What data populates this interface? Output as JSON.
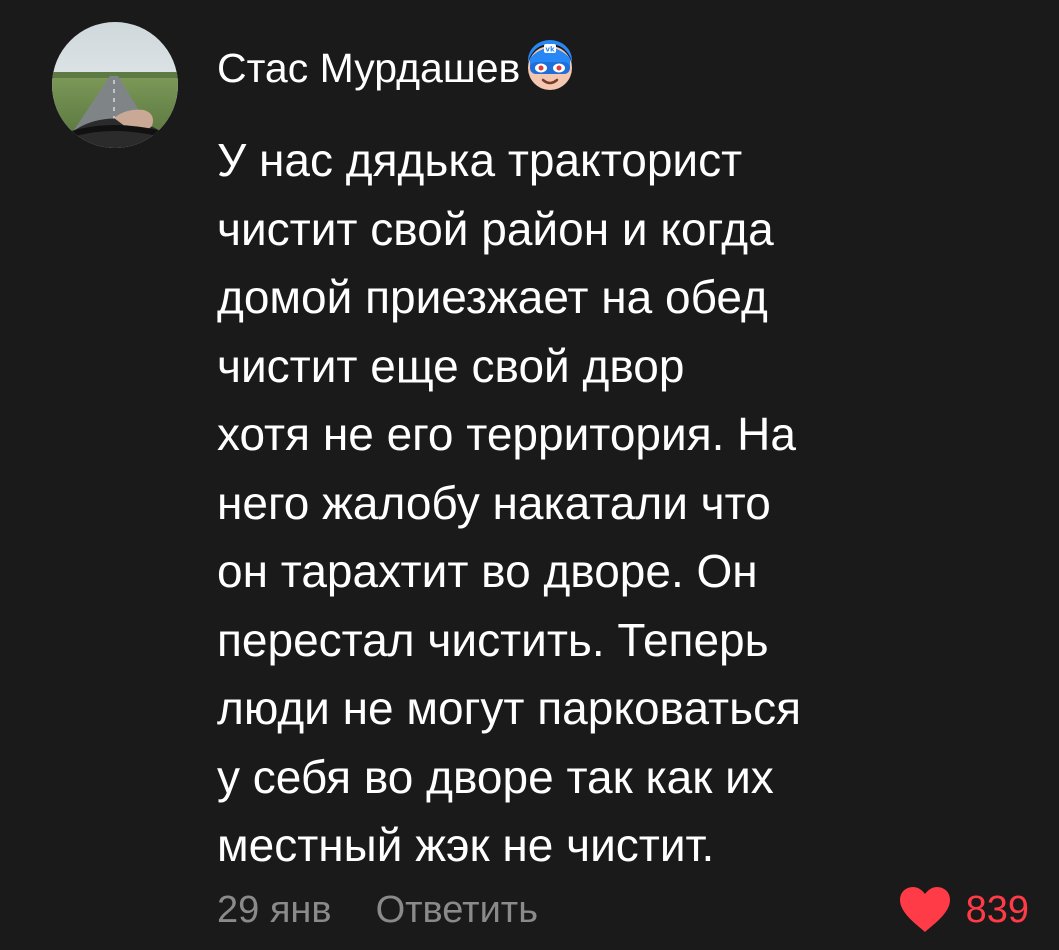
{
  "comment": {
    "author": "Стас Мурдашев",
    "badge_icon": "vk-hero-mask-icon",
    "avatar_icon": "road-driving-photo",
    "text_lines": [
      "У нас дядька тракторист",
      "чистит свой район и когда",
      "домой приезжает на обед",
      "чистит еще свой двор",
      "хотя не его территория. На",
      "него жалобу накатали что",
      "он тарахтит во дворе. Он",
      "перестал чистить. Теперь",
      "люди не могут парковаться",
      "у себя во дворе так как их",
      "местный жэк не чистит."
    ],
    "date": "29 янв",
    "reply_label": "Ответить",
    "like_icon": "heart-icon",
    "like_count": "839"
  },
  "colors": {
    "background": "#1a1a1a",
    "text": "#ffffff",
    "muted": "#8a8a8a",
    "like": "#ff3b47"
  }
}
